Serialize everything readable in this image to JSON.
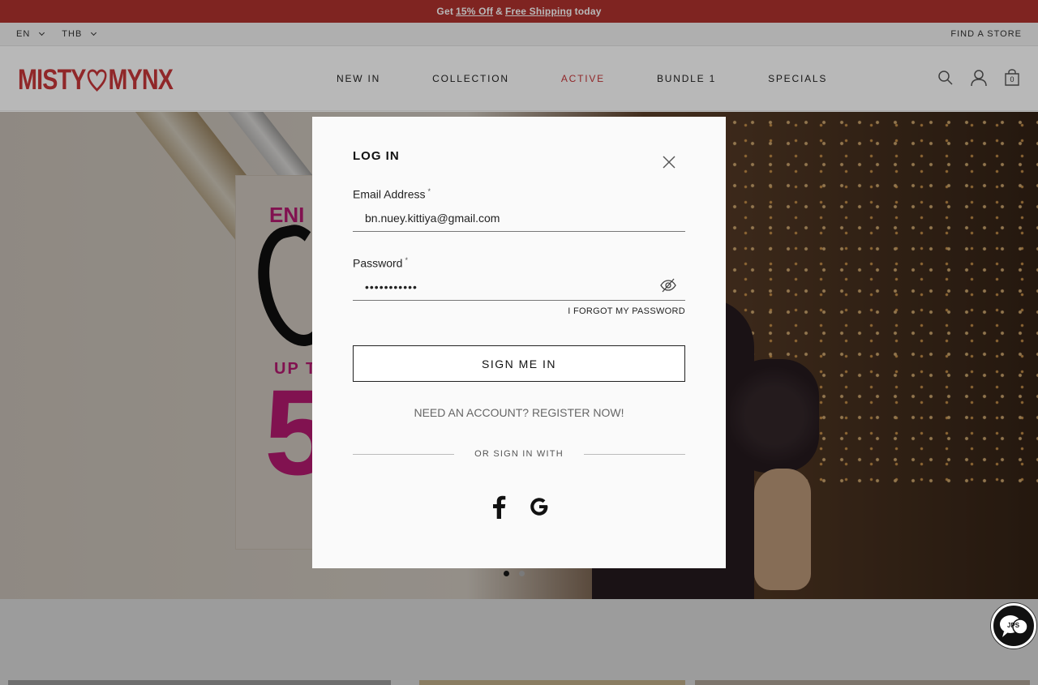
{
  "promo": {
    "prefix": "Get",
    "discount": "15% Off",
    "and": "&",
    "shipping": "Free Shipping",
    "suffix": "today"
  },
  "utility": {
    "language": "EN",
    "currency": "THB",
    "find_store": "FIND A STORE"
  },
  "brand": {
    "logo_left": "MISTY",
    "logo_right": "MYNX",
    "color": "#c8363a"
  },
  "nav": {
    "items": [
      {
        "label": "NEW IN"
      },
      {
        "label": "COLLECTION"
      },
      {
        "label": "ACTIVE",
        "active": true
      },
      {
        "label": "BUNDLE 1"
      },
      {
        "label": "SPECIALS"
      }
    ]
  },
  "header_icons": [
    "search-icon",
    "account-icon",
    "cart-icon"
  ],
  "cart": {
    "count": "0"
  },
  "hero": {
    "line1": "ENI",
    "line2": "UP T",
    "line3": "5",
    "slides": 2,
    "active_slide": 1
  },
  "modal": {
    "title": "LOG IN",
    "email_label": "Email Address",
    "email_value": "bn.nuey.kittiya@gmail.com",
    "password_label": "Password",
    "password_value": "•••••••••••",
    "required_mark": "*",
    "forgot": "I FORGOT MY PASSWORD",
    "submit": "SIGN ME IN",
    "register": "NEED AN ACCOUNT? REGISTER NOW!",
    "divider": "OR SIGN IN WITH",
    "social": [
      "facebook-icon",
      "google-icon"
    ]
  },
  "chat": {
    "label": "JPS"
  },
  "colors": {
    "promo_bg": "#b0322f",
    "accent": "#c8363a",
    "hero_pink": "#d11e82"
  }
}
